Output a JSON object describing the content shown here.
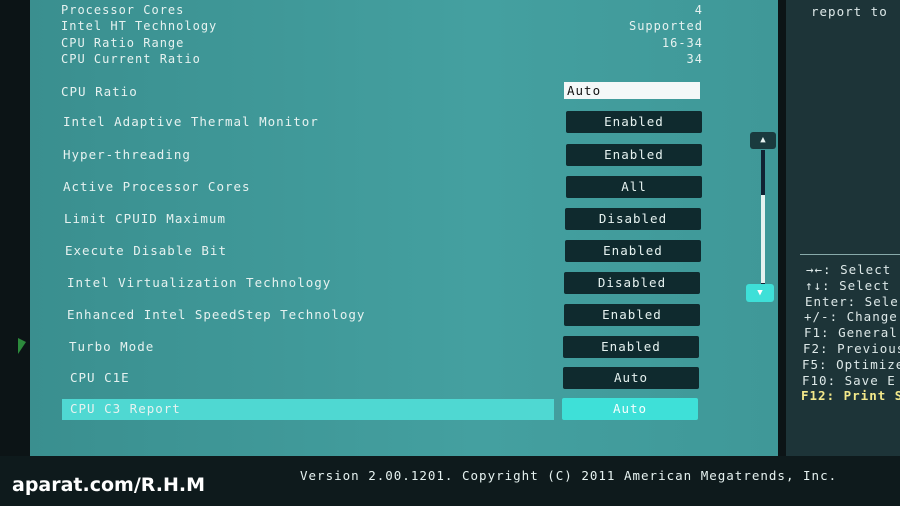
{
  "info": [
    {
      "label": "Processor Cores",
      "value": "4"
    },
    {
      "label": "Intel HT Technology",
      "value": "Supported"
    },
    {
      "label": "CPU Ratio Range",
      "value": "16-34"
    },
    {
      "label": "CPU Current Ratio",
      "value": "34"
    }
  ],
  "cpu_ratio": {
    "label": "CPU Ratio",
    "value": "Auto"
  },
  "settings": [
    {
      "label": "Intel Adaptive Thermal Monitor",
      "value": "Enabled"
    },
    {
      "label": "Hyper-threading",
      "value": "Enabled"
    },
    {
      "label": "Active Processor Cores",
      "value": "All"
    },
    {
      "label": "Limit CPUID Maximum",
      "value": "Disabled"
    },
    {
      "label": "Execute Disable Bit",
      "value": "Enabled"
    },
    {
      "label": "Intel Virtualization Technology",
      "value": "Disabled"
    },
    {
      "label": "Enhanced Intel SpeedStep Technology",
      "value": "Enabled"
    },
    {
      "label": "Turbo Mode",
      "value": "Enabled"
    },
    {
      "label": "CPU C1E",
      "value": "Auto"
    },
    {
      "label": "CPU C3 Report",
      "value": "Auto"
    }
  ],
  "side_help_top": "report to",
  "help": [
    "→←: Select",
    "↑↓: Select",
    "Enter: Sele",
    "+/-: Change",
    "F1: General",
    "F2: Previous",
    "F5: Optimize",
    "F10: Save E",
    "F12: Print S"
  ],
  "footer": "Version 2.00.1201. Copyright (C) 2011 American Megatrends, Inc.",
  "watermark": "aparat.com/R.H.M",
  "colors": {
    "panel": "#44a0a0",
    "button": "#0f2a2e",
    "highlight": "#4fd8d2"
  }
}
